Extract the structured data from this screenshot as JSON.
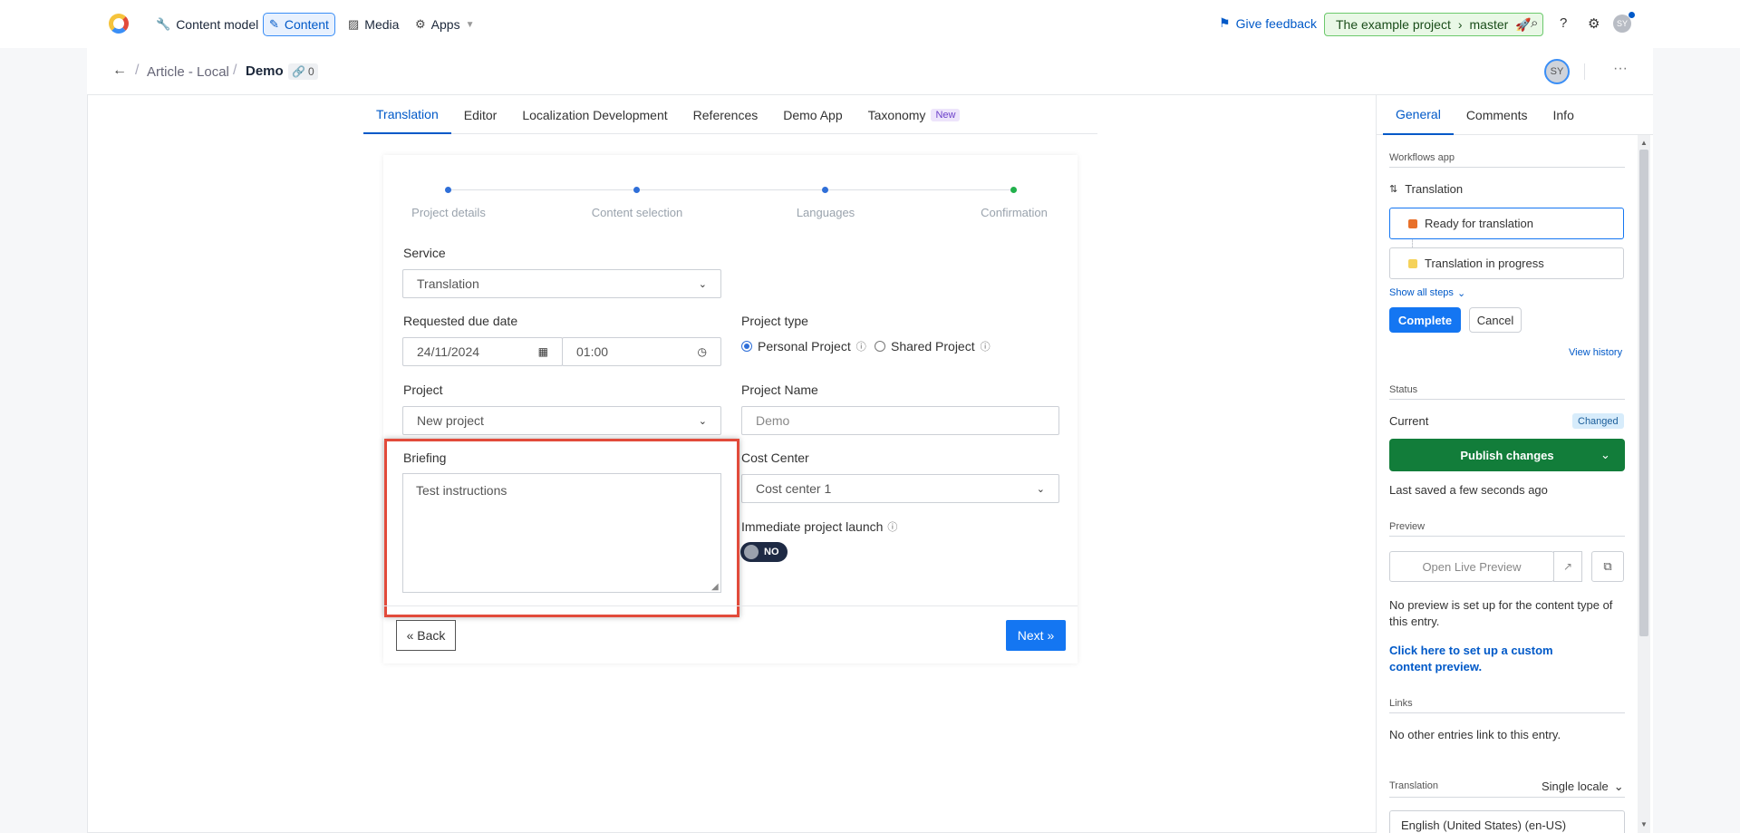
{
  "topnav": {
    "items": [
      {
        "label": "Content model",
        "icon": "wrench-icon"
      },
      {
        "label": "Content",
        "icon": "pencil-icon"
      },
      {
        "label": "Media",
        "icon": "image-icon"
      },
      {
        "label": "Apps",
        "icon": "puzzle-icon"
      }
    ],
    "feedback": "Give feedback",
    "env_project": "The example project",
    "env_branch": "master",
    "avatar": "SY"
  },
  "header": {
    "crumb1": "Article - Local",
    "crumb2": "Demo",
    "link_count": "0",
    "avatar": "SY",
    "more": "···"
  },
  "tabs": [
    "Translation",
    "Editor",
    "Localization Development",
    "References",
    "Demo App",
    "Taxonomy"
  ],
  "tab_new_badge": "New",
  "steps": [
    "Project details",
    "Content selection",
    "Languages",
    "Confirmation"
  ],
  "colors": {
    "step_blue": "#2f6fd8",
    "step_green": "#22b14c",
    "highlight": "#e24b3b",
    "publish": "#127d3a"
  },
  "form": {
    "service_label": "Service",
    "service_value": "Translation",
    "due_label": "Requested due date",
    "due_date": "24/11/2024",
    "due_time": "01:00",
    "ptype_label": "Project type",
    "ptype_personal": "Personal Project",
    "ptype_shared": "Shared Project",
    "project_label": "Project",
    "project_value": "New project",
    "pname_label": "Project Name",
    "pname_placeholder": "Demo",
    "briefing_label": "Briefing",
    "briefing_value": "Test instructions",
    "cost_label": "Cost Center",
    "cost_value": "Cost center 1",
    "launch_label": "Immediate project launch",
    "launch_toggle": "NO",
    "back": "« Back",
    "next": "Next »"
  },
  "sidebar": {
    "tabs": [
      "General",
      "Comments",
      "Info"
    ],
    "wf_heading": "Workflows app",
    "wf_name": "Translation",
    "wf_step1": "Ready for translation",
    "wf_step2": "Translation in progress",
    "show_all": "Show all steps",
    "complete": "Complete",
    "cancel": "Cancel",
    "view_history": "View history",
    "status_heading": "Status",
    "current": "Current",
    "changed": "Changed",
    "publish": "Publish changes",
    "last_saved": "Last saved a few seconds ago",
    "preview_heading": "Preview",
    "open_preview": "Open Live Preview",
    "no_preview": "No preview is set up for the content type of this entry.",
    "setup_link": "Click here to set up a custom content preview.",
    "links_heading": "Links",
    "no_links": "No other entries link to this entry.",
    "translation_heading": "Translation",
    "locale_mode": "Single locale",
    "locale": "English (United States) (en-US)"
  }
}
